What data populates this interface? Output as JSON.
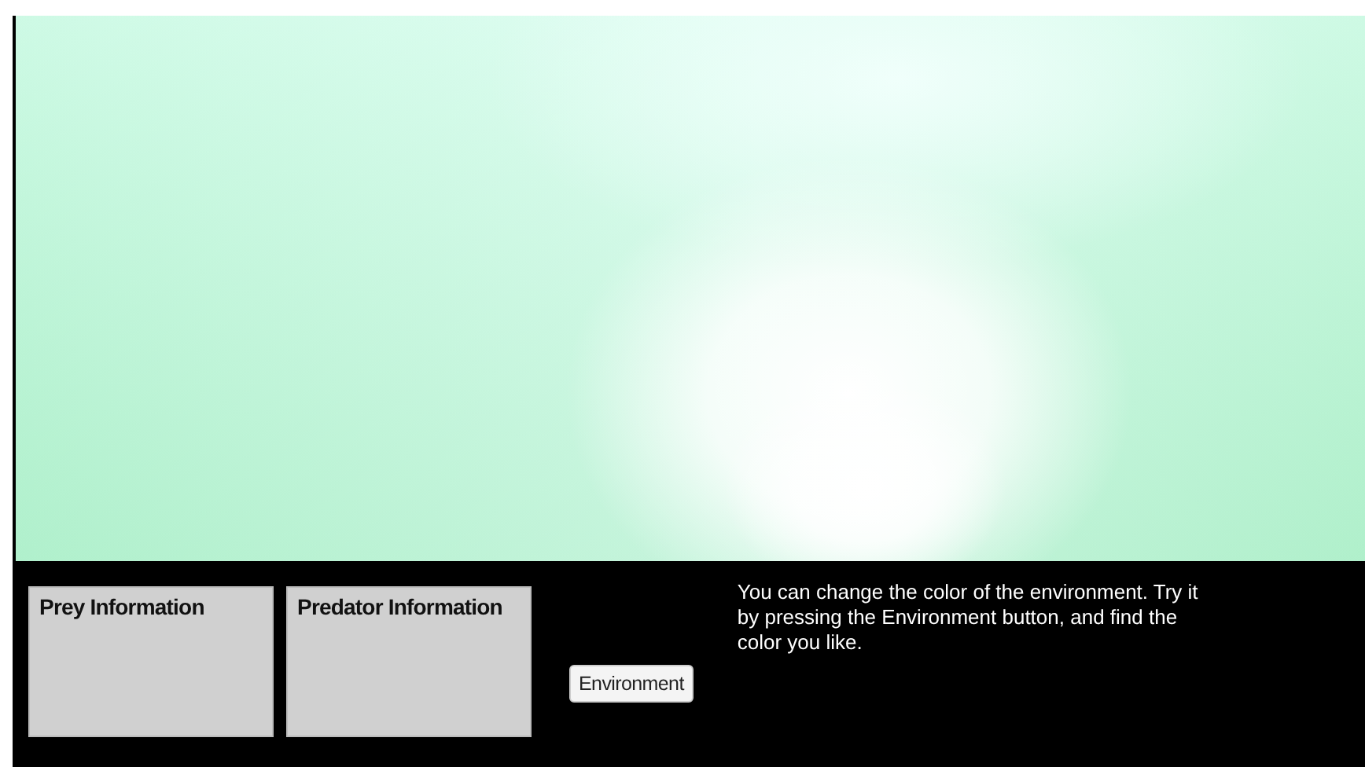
{
  "panels": [
    {
      "title": "Prey Information"
    },
    {
      "title": "Predator Information"
    }
  ],
  "button": {
    "label": "Environment"
  },
  "instructions": "You can change the color of the environment. Try it by pressing the Environment button, and find the color you like."
}
